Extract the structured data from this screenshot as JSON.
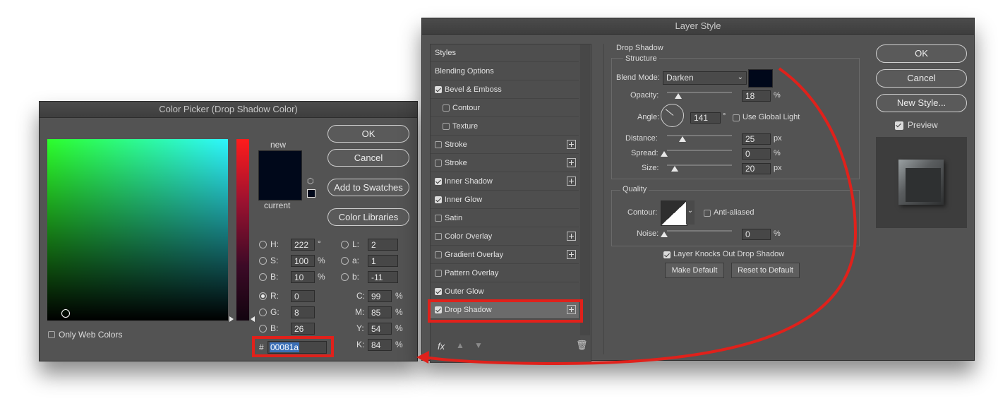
{
  "color_picker": {
    "title": "Color Picker (Drop Shadow Color)",
    "ok_label": "OK",
    "cancel_label": "Cancel",
    "add_swatches_label": "Add to Swatches",
    "color_libraries_label": "Color Libraries",
    "new_label": "new",
    "current_label": "current",
    "only_web_colors_label": "Only Web Colors",
    "swatch_color": "#00081a",
    "hsb": {
      "h_label": "H:",
      "h": "222",
      "h_unit": "°",
      "s_label": "S:",
      "s": "100",
      "s_unit": "%",
      "b_label": "B:",
      "b": "10",
      "b_unit": "%"
    },
    "lab": {
      "l_label": "L:",
      "l": "2",
      "a_label": "a:",
      "a": "1",
      "b_label": "b:",
      "b": "-11"
    },
    "rgb": {
      "r_label": "R:",
      "r": "0",
      "g_label": "G:",
      "g": "8",
      "b_label": "B:",
      "b": "26"
    },
    "cmyk": {
      "c_label": "C:",
      "c": "99",
      "m_label": "M:",
      "m": "85",
      "y_label": "Y:",
      "y": "54",
      "k_label": "K:",
      "k": "84",
      "unit": "%"
    },
    "hex_prefix": "#",
    "hex_value": "00081a"
  },
  "layer_style": {
    "title": "Layer Style",
    "effects": [
      {
        "label": "Styles",
        "checkbox": false,
        "plus": false,
        "indent": false
      },
      {
        "label": "Blending Options",
        "checkbox": false,
        "plus": false,
        "indent": false
      },
      {
        "label": "Bevel & Emboss",
        "checkbox": true,
        "checked": true,
        "plus": false,
        "indent": false
      },
      {
        "label": "Contour",
        "checkbox": true,
        "checked": false,
        "plus": false,
        "indent": true
      },
      {
        "label": "Texture",
        "checkbox": true,
        "checked": false,
        "plus": false,
        "indent": true
      },
      {
        "label": "Stroke",
        "checkbox": true,
        "checked": false,
        "plus": true,
        "indent": false
      },
      {
        "label": "Stroke",
        "checkbox": true,
        "checked": false,
        "plus": true,
        "indent": false
      },
      {
        "label": "Inner Shadow",
        "checkbox": true,
        "checked": true,
        "plus": true,
        "indent": false
      },
      {
        "label": "Inner Glow",
        "checkbox": true,
        "checked": true,
        "plus": false,
        "indent": false
      },
      {
        "label": "Satin",
        "checkbox": true,
        "checked": false,
        "plus": false,
        "indent": false
      },
      {
        "label": "Color Overlay",
        "checkbox": true,
        "checked": false,
        "plus": true,
        "indent": false
      },
      {
        "label": "Gradient Overlay",
        "checkbox": true,
        "checked": false,
        "plus": true,
        "indent": false
      },
      {
        "label": "Pattern Overlay",
        "checkbox": true,
        "checked": false,
        "plus": false,
        "indent": false
      },
      {
        "label": "Outer Glow",
        "checkbox": true,
        "checked": true,
        "plus": false,
        "indent": false
      },
      {
        "label": "Drop Shadow",
        "checkbox": true,
        "checked": true,
        "plus": true,
        "indent": false,
        "selected": true
      }
    ],
    "fx_label": "fx",
    "drop_shadow": {
      "section_title": "Drop Shadow",
      "structure_title": "Structure",
      "blend_mode_label": "Blend Mode:",
      "blend_mode": "Darken",
      "shadow_color": "#00081a",
      "opacity_label": "Opacity:",
      "opacity": "18",
      "opacity_unit": "%",
      "angle_label": "Angle:",
      "angle": "141",
      "angle_unit": "°",
      "use_global_light_label": "Use Global Light",
      "distance_label": "Distance:",
      "distance": "25",
      "distance_unit": "px",
      "spread_label": "Spread:",
      "spread": "0",
      "spread_unit": "%",
      "size_label": "Size:",
      "size": "20",
      "size_unit": "px",
      "quality_title": "Quality",
      "contour_label": "Contour:",
      "anti_aliased_label": "Anti-aliased",
      "noise_label": "Noise:",
      "noise": "0",
      "noise_unit": "%",
      "knocks_out_label": "Layer Knocks Out Drop Shadow",
      "make_default_label": "Make Default",
      "reset_default_label": "Reset to Default"
    },
    "ok_label": "OK",
    "cancel_label": "Cancel",
    "new_style_label": "New Style...",
    "preview_label": "Preview"
  },
  "colors": {
    "highlight_red": "#e0211b",
    "hex_selection": "#3b6fb6"
  }
}
